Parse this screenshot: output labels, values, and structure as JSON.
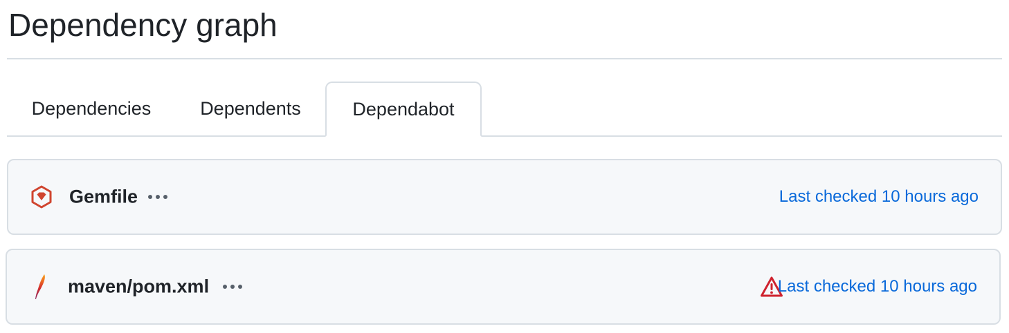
{
  "page": {
    "title": "Dependency graph"
  },
  "tabs": [
    {
      "label": "Dependencies",
      "selected": false
    },
    {
      "label": "Dependents",
      "selected": false
    },
    {
      "label": "Dependabot",
      "selected": true
    }
  ],
  "manifests": [
    {
      "name": "Gemfile",
      "icon": "ruby-gem-icon",
      "icon_color": "#d0452f",
      "status_text": "Last checked 10 hours ago",
      "has_alert": false
    },
    {
      "name": "maven/pom.xml",
      "icon": "apache-feather-icon",
      "icon_color": "#c22e4a",
      "status_text": "Last checked 10 hours ago",
      "has_alert": true,
      "alert_icon": "alert-triangle-icon",
      "alert_color": "#cf222e"
    }
  ],
  "colors": {
    "link": "#0969da",
    "border": "#d8dee4",
    "row_background": "#f6f8fa"
  }
}
